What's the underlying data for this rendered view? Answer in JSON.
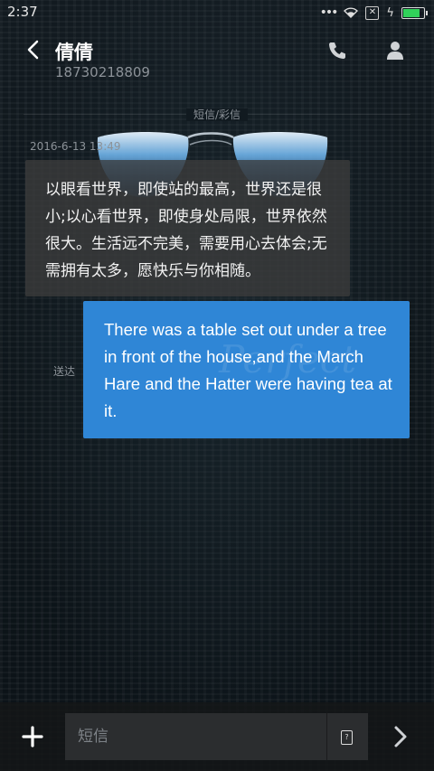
{
  "status_bar": {
    "time": "2:37",
    "dots": "•••",
    "sim": "✕",
    "battery_level_percent": 85,
    "battery_color": "#31d15a"
  },
  "header": {
    "contact_name": "倩倩",
    "contact_number": "18730218809"
  },
  "conversation": {
    "type_label": "短信/彩信",
    "timestamp": "2016-6-13 13:49",
    "incoming_message": "以眼看世界，即使站的最高，世界还是很小;以心看世界，即使身处局限，世界依然很大。生活远不完美，需要用心去体会;无需拥有太多，愿快乐与你相随。",
    "outgoing_message": "There was a table set out under a tree in front of the house,and the March Hare and the Hatter were having tea at it.",
    "outgoing_watermark": "Perfect",
    "sent_status": "送达",
    "outgoing_color": "#2f86d6"
  },
  "input": {
    "placeholder": "短信",
    "attach_icon_text": "?"
  },
  "icons": {
    "back": "chevron-left-icon",
    "call": "phone-icon",
    "contact": "person-icon",
    "add": "plus-icon",
    "attach": "sim-card-icon",
    "send": "chevron-right-icon"
  }
}
